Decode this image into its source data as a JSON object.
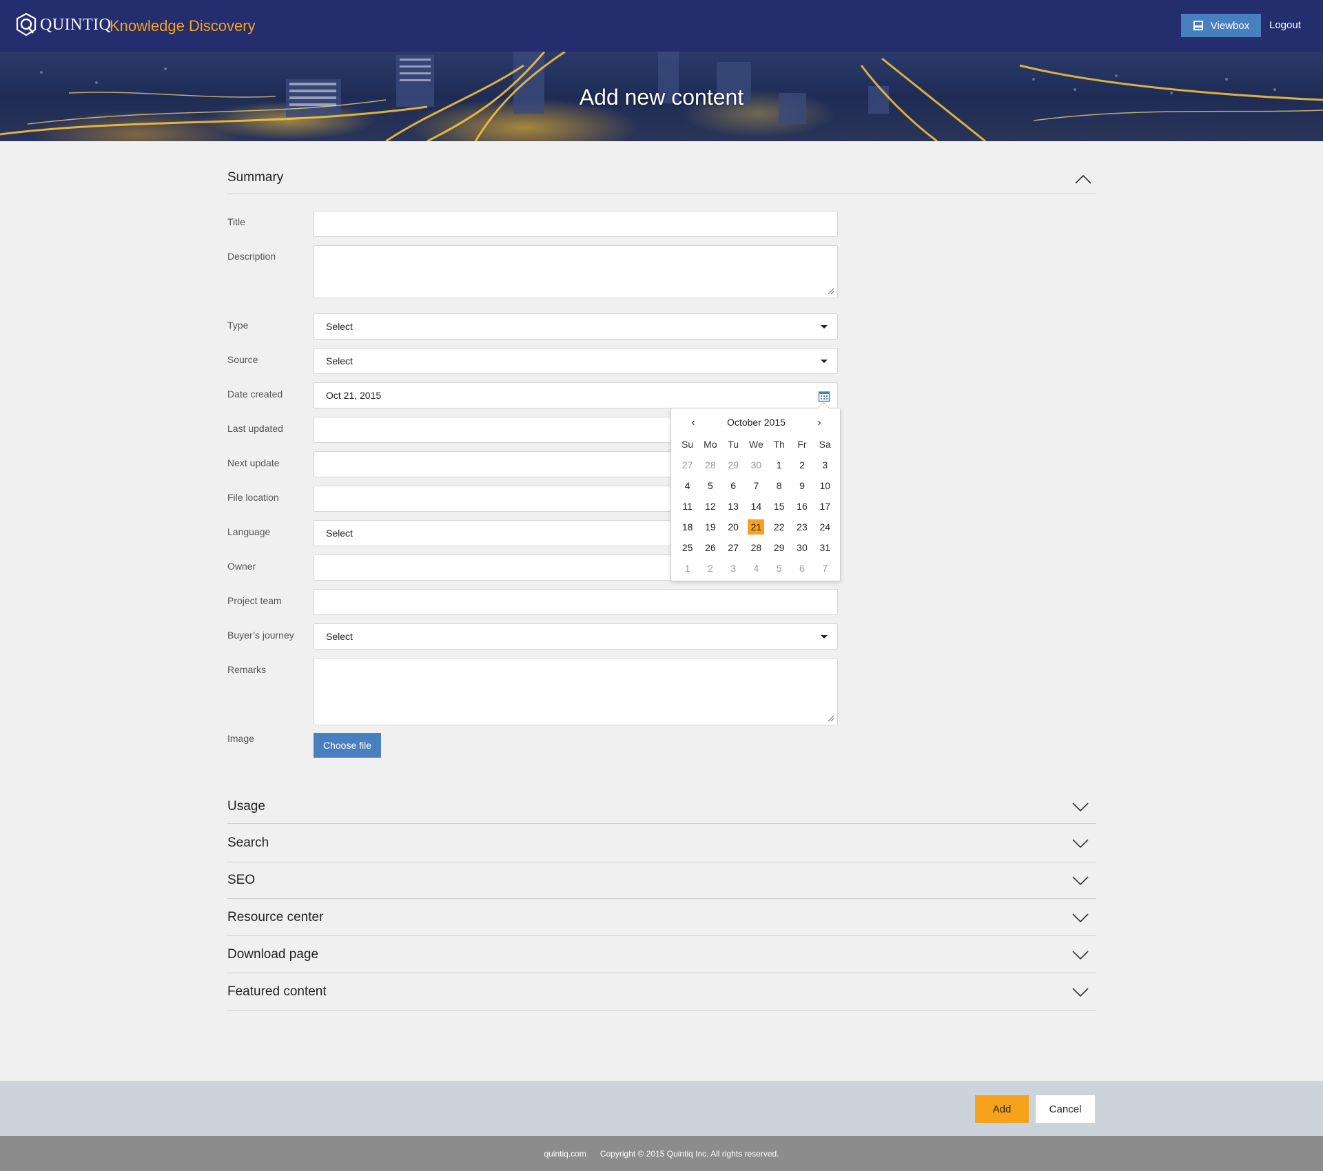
{
  "header": {
    "logo_text": "QUINTIQ",
    "app_title": "Knowledge Discovery",
    "viewbox_label": "Viewbox",
    "logout_label": "Logout"
  },
  "hero": {
    "title": "Add new content"
  },
  "summary": {
    "heading": "Summary",
    "fields": {
      "title": {
        "label": "Title",
        "value": ""
      },
      "description": {
        "label": "Description",
        "value": ""
      },
      "type": {
        "label": "Type",
        "value": "Select"
      },
      "source": {
        "label": "Source",
        "value": "Select"
      },
      "date_created": {
        "label": "Date created",
        "value": "Oct 21, 2015"
      },
      "last_updated": {
        "label": "Last updated",
        "value": ""
      },
      "next_update": {
        "label": "Next update",
        "value": ""
      },
      "file_location": {
        "label": "File location",
        "value": ""
      },
      "language": {
        "label": "Language",
        "value": "Select"
      },
      "owner": {
        "label": "Owner",
        "value": ""
      },
      "project_team": {
        "label": "Project team",
        "value": ""
      },
      "buyers_journey": {
        "label": "Buyer’s journey",
        "value": "Select"
      },
      "remarks": {
        "label": "Remarks",
        "value": ""
      },
      "image": {
        "label": "Image",
        "button": "Choose file"
      }
    }
  },
  "datepicker": {
    "month_label": "October 2015",
    "prev": "‹",
    "next": "›",
    "weekdays": [
      "Su",
      "Mo",
      "Tu",
      "We",
      "Th",
      "Fr",
      "Sa"
    ],
    "weeks": [
      [
        "27",
        "28",
        "29",
        "30",
        "1",
        "2",
        "3"
      ],
      [
        "4",
        "5",
        "6",
        "7",
        "8",
        "9",
        "10"
      ],
      [
        "11",
        "12",
        "13",
        "14",
        "15",
        "16",
        "17"
      ],
      [
        "18",
        "19",
        "20",
        "21",
        "22",
        "23",
        "24"
      ],
      [
        "25",
        "26",
        "27",
        "28",
        "29",
        "30",
        "31"
      ],
      [
        "1",
        "2",
        "3",
        "4",
        "5",
        "6",
        "7"
      ]
    ],
    "selected": "21",
    "accent_color": "#f7a21b"
  },
  "sections": [
    {
      "label": "Usage"
    },
    {
      "label": "Search"
    },
    {
      "label": "SEO"
    },
    {
      "label": "Resource center"
    },
    {
      "label": "Download page"
    },
    {
      "label": "Featured content"
    }
  ],
  "actions": {
    "add_label": "Add",
    "cancel_label": "Cancel"
  },
  "footer": {
    "site": "quintiq.com",
    "copyright": "Copyright © 2015 Quintiq Inc. All rights reserved."
  },
  "colors": {
    "header_bg": "#242d6e",
    "accent": "#f7a21b",
    "primary_button": "#4a7fbf"
  }
}
